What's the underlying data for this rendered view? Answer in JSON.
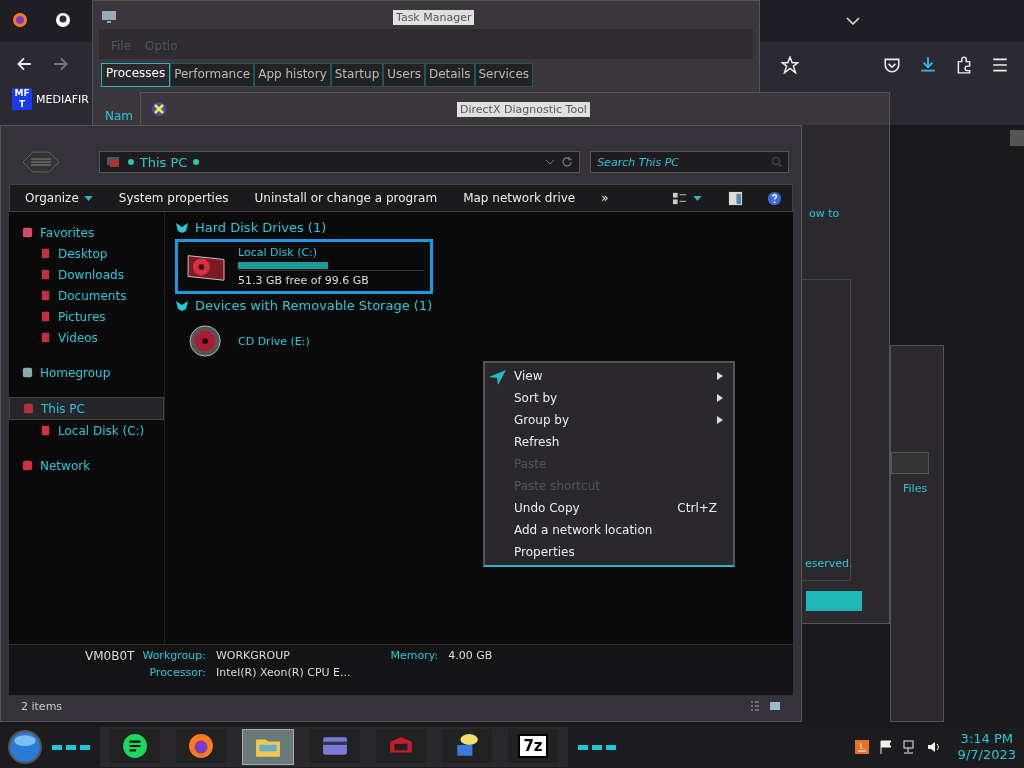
{
  "browser": {
    "bookmark": {
      "icon_text": [
        "MF",
        "T"
      ],
      "label": "MEDIAFIR"
    }
  },
  "task_manager": {
    "title": "Task Manager",
    "menu": [
      "File",
      "Optio"
    ],
    "tabs": [
      {
        "label": "Processes",
        "selected": true
      },
      {
        "label": "Performance",
        "selected": false
      },
      {
        "label": "App history",
        "selected": false
      },
      {
        "label": "Startup",
        "selected": false
      },
      {
        "label": "Users",
        "selected": false
      },
      {
        "label": "Details",
        "selected": false
      },
      {
        "label": "Services",
        "selected": false
      }
    ],
    "column_1": "Nam"
  },
  "dxdiag": {
    "title": "DirectX Diagnostic Tool",
    "text_1": "ow to",
    "text_2": "eserved."
  },
  "back_window": {
    "text": "Files"
  },
  "explorer": {
    "address": "This PC",
    "search": {
      "placeholder": "Search This PC"
    },
    "toolbar": [
      {
        "label": "Organize",
        "dropdown": true
      },
      {
        "label": "System properties",
        "dropdown": false
      },
      {
        "label": "Uninstall or change a program",
        "dropdown": false
      },
      {
        "label": "Map network drive",
        "dropdown": false
      },
      {
        "label": "»",
        "dropdown": false
      }
    ],
    "nav": [
      {
        "label": "Favorites",
        "kind": "star",
        "selected": false,
        "children": [
          {
            "label": "Desktop",
            "kind": "desktop",
            "selected": false
          },
          {
            "label": "Downloads",
            "kind": "download",
            "selected": false
          },
          {
            "label": "Documents",
            "kind": "document",
            "selected": false
          },
          {
            "label": "Pictures",
            "kind": "picture",
            "selected": false
          },
          {
            "label": "Videos",
            "kind": "video",
            "selected": false
          }
        ]
      },
      {
        "label": "Homegroup",
        "kind": "homegroup",
        "selected": false
      },
      {
        "label": "This PC",
        "kind": "pc",
        "selected": true,
        "children": [
          {
            "label": "Local Disk (C:)",
            "kind": "disk",
            "selected": false
          }
        ]
      },
      {
        "label": "Network",
        "kind": "network",
        "selected": false
      }
    ],
    "groups": [
      {
        "title": "Hard Disk Drives (1)",
        "items": [
          {
            "kind": "disk",
            "name": "Local Disk (C:)",
            "selected": true,
            "level": 0.485,
            "free": "51.3 GB free of 99.6 GB"
          }
        ]
      },
      {
        "title": "Devices with Removable Storage (1)",
        "items": [
          {
            "kind": "cd",
            "name": "CD Drive (E:)",
            "selected": false
          }
        ]
      }
    ],
    "details": {
      "name": "VM0B0T",
      "fields": [
        {
          "label": "Workgroup:",
          "value": "WORKGROUP"
        },
        {
          "label": "Memory:",
          "value": "4.00 GB"
        },
        {
          "label": "Processor:",
          "value": "Intel(R) Xeon(R) CPU E..."
        }
      ]
    },
    "status": "2 items"
  },
  "context_menu": [
    {
      "label": "View",
      "submenu": true,
      "disabled": false
    },
    {
      "label": "Sort by",
      "submenu": true,
      "disabled": false
    },
    {
      "label": "Group by",
      "submenu": true,
      "disabled": false
    },
    {
      "label": "Refresh",
      "submenu": false,
      "disabled": false
    },
    {
      "label": "Paste",
      "submenu": false,
      "disabled": true
    },
    {
      "label": "Paste shortcut",
      "submenu": false,
      "disabled": true
    },
    {
      "label": "Undo Copy",
      "shortcut": "Ctrl+Z",
      "submenu": false,
      "disabled": false
    },
    {
      "label": "Add a network location",
      "submenu": false,
      "disabled": false
    },
    {
      "label": "Properties",
      "submenu": false,
      "disabled": false
    }
  ],
  "taskbar": {
    "apps": [
      {
        "kind": "notes",
        "selected": false
      },
      {
        "kind": "firefox",
        "selected": false
      },
      {
        "kind": "folder",
        "selected": true
      },
      {
        "kind": "card",
        "selected": false
      },
      {
        "kind": "game",
        "selected": false
      },
      {
        "kind": "monitor",
        "selected": false
      },
      {
        "kind": "archive",
        "label": "7z",
        "selected": false
      }
    ],
    "time": "3:14 PM",
    "date": "9/7/2023"
  }
}
